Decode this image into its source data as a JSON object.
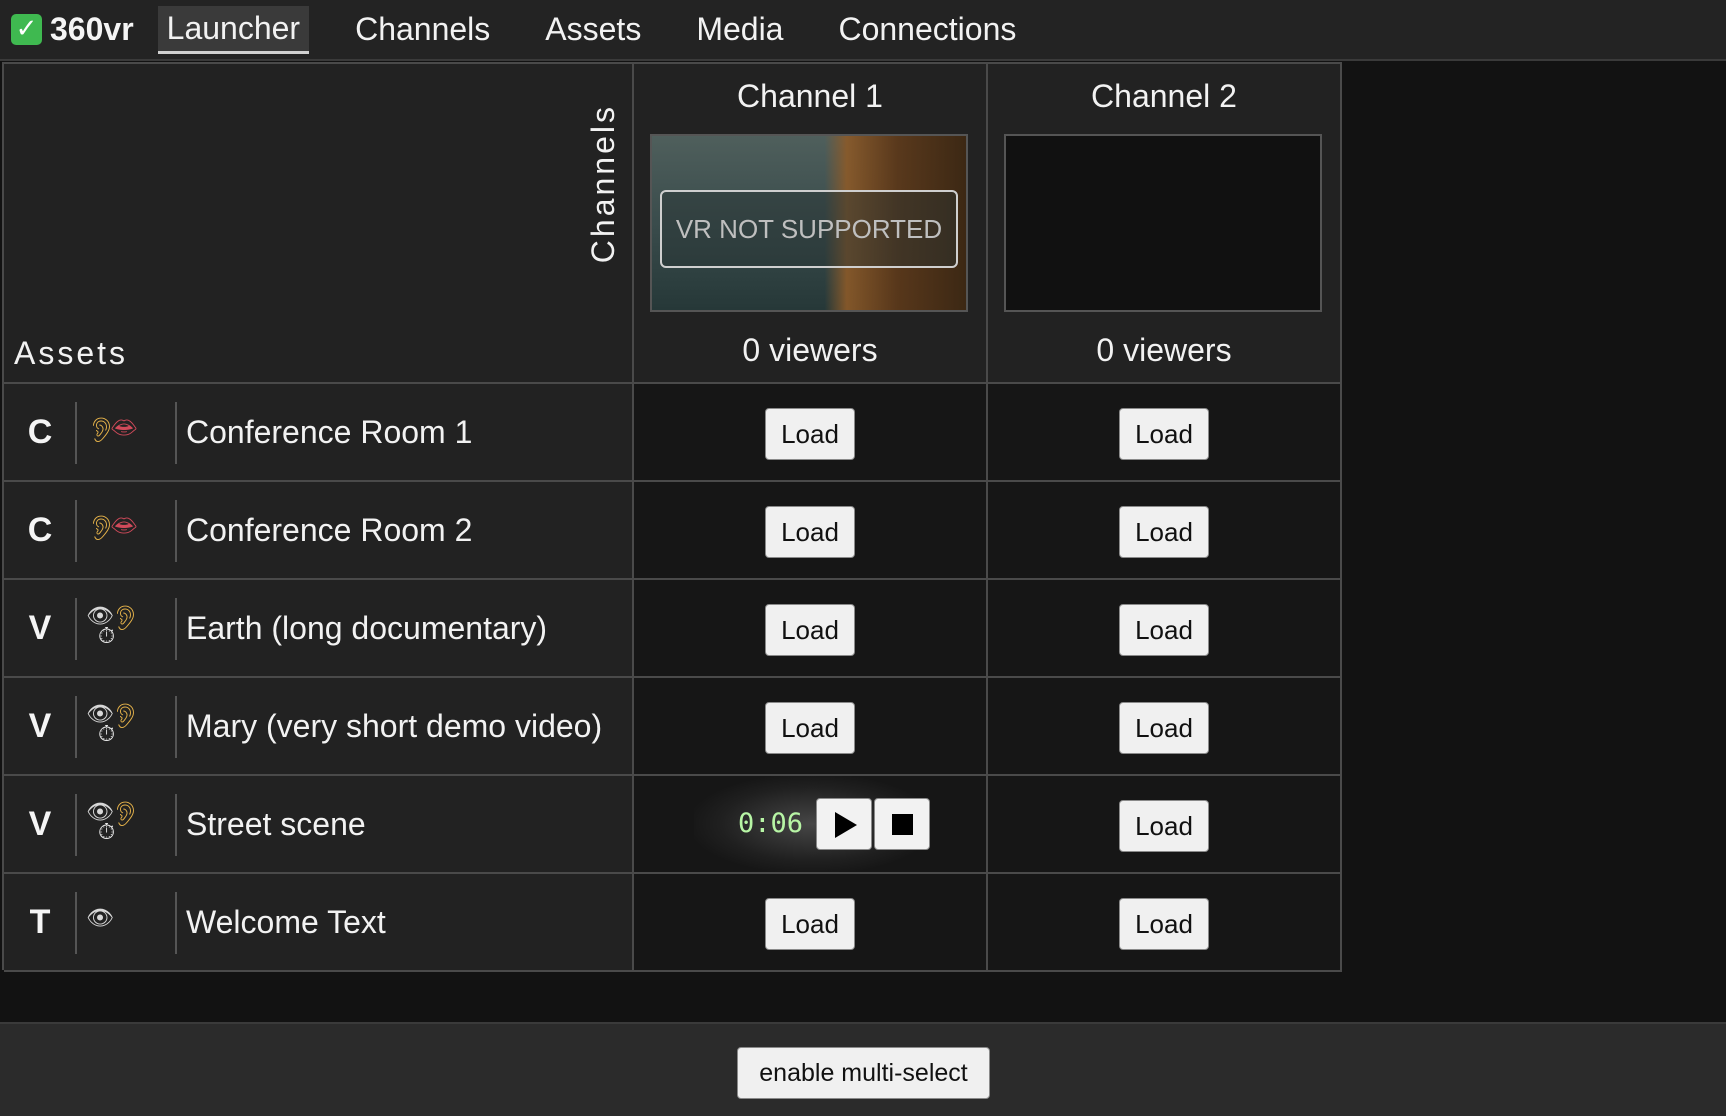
{
  "app": {
    "name": "360vr",
    "status_icon": "check-icon"
  },
  "nav": {
    "items": [
      {
        "label": "Launcher",
        "active": true
      },
      {
        "label": "Channels",
        "active": false
      },
      {
        "label": "Assets",
        "active": false
      },
      {
        "label": "Media",
        "active": false
      },
      {
        "label": "Connections",
        "active": false
      }
    ]
  },
  "grid": {
    "assets_label": "Assets",
    "channels_label": "Channels",
    "channels": [
      {
        "title": "Channel 1",
        "viewers": "0 viewers",
        "preview": "video",
        "overlay": "VR NOT SUPPORTED"
      },
      {
        "title": "Channel 2",
        "viewers": "0 viewers",
        "preview": "empty",
        "overlay": ""
      }
    ],
    "load_label": "Load",
    "assets": [
      {
        "type": "C",
        "icons": [
          "ear-icon",
          "lips-icon"
        ],
        "name": "Conference Room 1",
        "slots": [
          {
            "state": "load"
          },
          {
            "state": "load"
          }
        ]
      },
      {
        "type": "C",
        "icons": [
          "ear-icon",
          "lips-icon"
        ],
        "name": "Conference Room 2",
        "slots": [
          {
            "state": "load"
          },
          {
            "state": "load"
          }
        ]
      },
      {
        "type": "V",
        "icons": [
          "eye-icon",
          "ear-icon",
          "stopwatch-icon"
        ],
        "name": "Earth (long documentary)",
        "slots": [
          {
            "state": "load"
          },
          {
            "state": "load"
          }
        ]
      },
      {
        "type": "V",
        "icons": [
          "eye-icon",
          "ear-icon",
          "stopwatch-icon"
        ],
        "name": "Mary (very short demo video)",
        "slots": [
          {
            "state": "load"
          },
          {
            "state": "load"
          }
        ]
      },
      {
        "type": "V",
        "icons": [
          "eye-icon",
          "ear-icon",
          "stopwatch-icon"
        ],
        "name": "Street scene",
        "slots": [
          {
            "state": "playing",
            "time": "0:06"
          },
          {
            "state": "load"
          }
        ]
      },
      {
        "type": "T",
        "icons": [
          "eye-icon"
        ],
        "name": "Welcome Text",
        "slots": [
          {
            "state": "load"
          },
          {
            "state": "load"
          }
        ]
      }
    ]
  },
  "footer": {
    "multi_select_label": "enable multi-select"
  },
  "colors": {
    "accent_check": "#3fb950",
    "timer": "#b7f5a5"
  }
}
